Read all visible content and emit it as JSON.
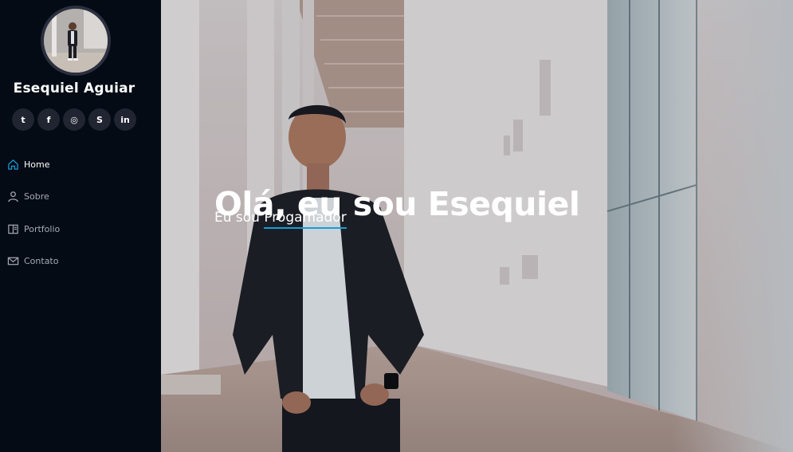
{
  "profile": {
    "name": "Esequiel Aguiar"
  },
  "social": [
    {
      "icon": "twitter-icon",
      "glyph": "t"
    },
    {
      "icon": "facebook-icon",
      "glyph": "f"
    },
    {
      "icon": "instagram-icon",
      "glyph": "◎"
    },
    {
      "icon": "skype-icon",
      "glyph": "S"
    },
    {
      "icon": "linkedin-icon",
      "glyph": "in"
    }
  ],
  "nav": {
    "items": [
      {
        "label": "Home",
        "icon": "home-icon",
        "active": true
      },
      {
        "label": "Sobre",
        "icon": "person-icon",
        "active": false
      },
      {
        "label": "Portfolio",
        "icon": "book-icon",
        "active": false
      },
      {
        "label": "Contato",
        "icon": "envelope-icon",
        "active": false
      }
    ]
  },
  "hero": {
    "title": "Olá, eu sou Esequiel",
    "subtitle_prefix": "Eu sou ",
    "subtitle_typed": "Progamador"
  },
  "colors": {
    "sidebar_bg": "#040b14",
    "social_bg": "#212431",
    "accent": "#149ddd",
    "nav_text": "#a8a9b4"
  }
}
